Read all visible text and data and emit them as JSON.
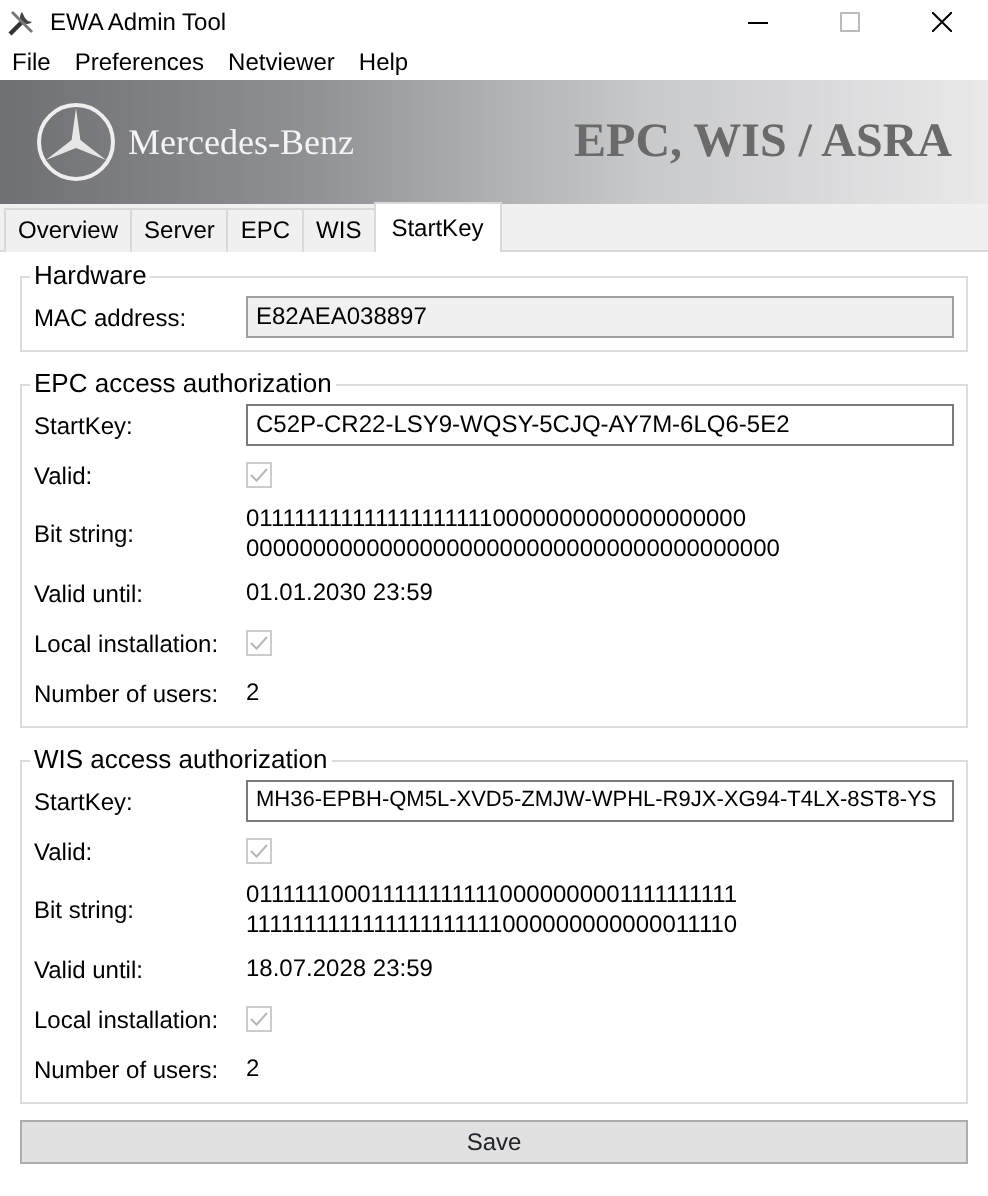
{
  "window": {
    "title": "EWA Admin Tool"
  },
  "menu": [
    "File",
    "Preferences",
    "Netviewer",
    "Help"
  ],
  "banner": {
    "brand": "Mercedes-Benz",
    "product": "EPC, WIS / ASRA"
  },
  "tabs": [
    {
      "label": "Overview",
      "selected": false
    },
    {
      "label": "Server",
      "selected": false
    },
    {
      "label": "EPC",
      "selected": false
    },
    {
      "label": "WIS",
      "selected": false
    },
    {
      "label": "StartKey",
      "selected": true
    }
  ],
  "sections": [
    {
      "title": "Hardware",
      "rows": [
        {
          "kind": "input",
          "label": "MAC address:",
          "value": "E82AEA038897",
          "readonly": true
        }
      ]
    },
    {
      "title": "EPC access authorization",
      "rows": [
        {
          "kind": "input",
          "label": "StartKey:",
          "value": "C52P-CR22-LSY9-WQSY-5CJQ-AY7M-6LQ6-5E2",
          "readonly": false
        },
        {
          "kind": "checkbox",
          "label": "Valid:",
          "checked": true
        },
        {
          "kind": "text",
          "label": "Bit string:",
          "lines": [
            "0111111111111111111110000000000000000000",
            "0000000000000000000000000000000000000000"
          ]
        },
        {
          "kind": "text",
          "label": "Valid until:",
          "lines": [
            "01.01.2030 23:59"
          ]
        },
        {
          "kind": "checkbox",
          "label": "Local installation:",
          "checked": true
        },
        {
          "kind": "text",
          "label": "Number of users:",
          "lines": [
            "2"
          ]
        }
      ]
    },
    {
      "title": "WIS access authorization",
      "rows": [
        {
          "kind": "input",
          "label": "StartKey:",
          "value": "MH36-EPBH-QM5L-XVD5-ZMJW-WPHL-R9JX-XG94-T4LX-8ST8-YS",
          "readonly": false
        },
        {
          "kind": "checkbox",
          "label": "Valid:",
          "checked": true
        },
        {
          "kind": "text",
          "label": "Bit string:",
          "lines": [
            "0111111000111111111110000000001111111111",
            "1111111111111111111111000000000000011110"
          ]
        },
        {
          "kind": "text",
          "label": "Valid until:",
          "lines": [
            "18.07.2028 23:59"
          ]
        },
        {
          "kind": "checkbox",
          "label": "Local installation:",
          "checked": true
        },
        {
          "kind": "text",
          "label": "Number of users:",
          "lines": [
            "2"
          ]
        }
      ]
    }
  ],
  "buttons": [
    "Save"
  ]
}
